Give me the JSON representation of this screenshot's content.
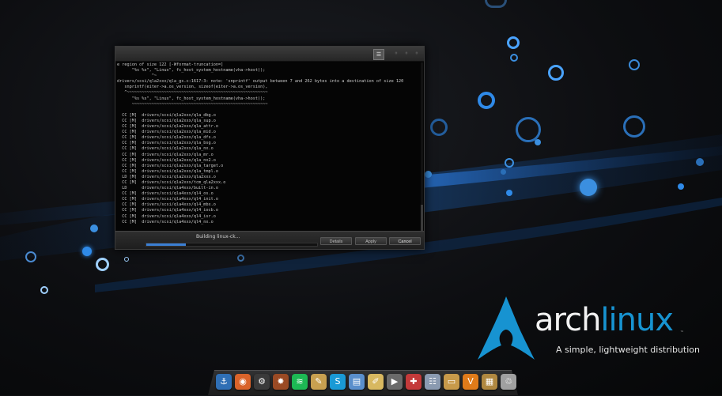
{
  "wallpaper": {
    "brand_arch": "arch",
    "brand_linux": "linux",
    "trademark": "™",
    "tagline": "A simple, lightweight distribution",
    "colors": {
      "arch_blue": "#1793d1",
      "bubble_blue": "#3b8fe0"
    }
  },
  "terminal": {
    "menu_icon": "menu-icon",
    "output_lines": [
      "e region of size 122 [-Wformat-truncation=]",
      "      \"%s %s\", \"Linux\", fc_host_system_hostname(vha->host));",
      "              ^~",
      "drivers/scsi/qla2xxx/qla_gs.c:1617:3: note: 'snprintf' output between 7 and 262 bytes into a destination of size 120",
      "   snprintf(eiter->a.os_version, sizeof(eiter->a.os_version),",
      "   ^~~~~~~~~~~~~~~~~~~~~~~~~~~~~~~~~~~~~~~~~~~~~~~~~~~~~~~~~~",
      "      \"%s %s\", \"Linux\", fc_host_system_hostname(vha->host));",
      "      ~~~~~~~~~~~~~~~~~~~~~~~~~~~~~~~~~~~~~~~~~~~~~~~~~~~~~~~",
      "",
      "  CC [M]  drivers/scsi/qla2xxx/qla_dbg.o",
      "  CC [M]  drivers/scsi/qla2xxx/qla_sup.o",
      "  CC [M]  drivers/scsi/qla2xxx/qla_attr.o",
      "  CC [M]  drivers/scsi/qla2xxx/qla_mid.o",
      "  CC [M]  drivers/scsi/qla2xxx/qla_dfs.o",
      "  CC [M]  drivers/scsi/qla2xxx/qla_bsg.o",
      "  CC [M]  drivers/scsi/qla2xxx/qla_nx.o",
      "  CC [M]  drivers/scsi/qla2xxx/qla_mr.o",
      "  CC [M]  drivers/scsi/qla2xxx/qla_nx2.o",
      "  CC [M]  drivers/scsi/qla2xxx/qla_target.o",
      "  CC [M]  drivers/scsi/qla2xxx/qla_tmpl.o",
      "  LD [M]  drivers/scsi/qla2xxx/qla2xxx.o",
      "  CC [M]  drivers/scsi/qla2xxx/tcm_qla2xxx.o",
      "  LD      drivers/scsi/qla4xxx/built-in.o",
      "  CC [M]  drivers/scsi/qla4xxx/ql4_os.o",
      "  CC [M]  drivers/scsi/qla4xxx/ql4_init.o",
      "  CC [M]  drivers/scsi/qla4xxx/ql4_mbx.o",
      "  CC [M]  drivers/scsi/qla4xxx/ql4_iocb.o",
      "  CC [M]  drivers/scsi/qla4xxx/ql4_isr.o",
      "  CC [M]  drivers/scsi/qla4xxx/ql4_nx.o"
    ],
    "status_text": "Building linux-ck...",
    "progress": 0.23,
    "buttons": {
      "details": "Details",
      "apply": "Apply",
      "cancel": "Cancel"
    }
  },
  "dock": {
    "icons": [
      {
        "name": "anchor-icon",
        "glyph": "⚓",
        "color": "#2f6fb5"
      },
      {
        "name": "firefox-icon",
        "glyph": "◉",
        "color": "#d9632a"
      },
      {
        "name": "steam-icon",
        "glyph": "⚙",
        "color": "#3a3a3a"
      },
      {
        "name": "octopi-icon",
        "glyph": "✸",
        "color": "#9a4a24"
      },
      {
        "name": "spotify-icon",
        "glyph": "≋",
        "color": "#1db954"
      },
      {
        "name": "image-editor-icon",
        "glyph": "✎",
        "color": "#c8a050"
      },
      {
        "name": "skype-icon",
        "glyph": "S",
        "color": "#1a9ad6"
      },
      {
        "name": "document-viewer-icon",
        "glyph": "▤",
        "color": "#5a8fcc"
      },
      {
        "name": "text-editor-icon",
        "glyph": "✐",
        "color": "#d8b860"
      },
      {
        "name": "video-editor-icon",
        "glyph": "▶",
        "color": "#6a6a6a"
      },
      {
        "name": "software-center-icon",
        "glyph": "✚",
        "color": "#c43a3a"
      },
      {
        "name": "settings-icon",
        "glyph": "☷",
        "color": "#8a9ab0"
      },
      {
        "name": "files-icon",
        "glyph": "▭",
        "color": "#c89a4a"
      },
      {
        "name": "vlc-icon",
        "glyph": "V",
        "color": "#e07b1a"
      },
      {
        "name": "archive-icon",
        "glyph": "▦",
        "color": "#b08840"
      },
      {
        "name": "trash-icon",
        "glyph": "♲",
        "color": "#a0a0a0"
      }
    ]
  }
}
